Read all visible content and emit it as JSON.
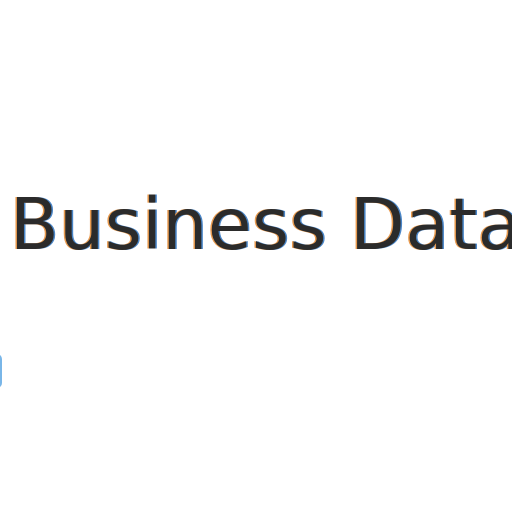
{
  "header": {
    "title": "Business Datab"
  },
  "colors": {
    "background": "#ffffff",
    "title_text": "#2b2b2b",
    "link_accent": "#62a9e4"
  }
}
